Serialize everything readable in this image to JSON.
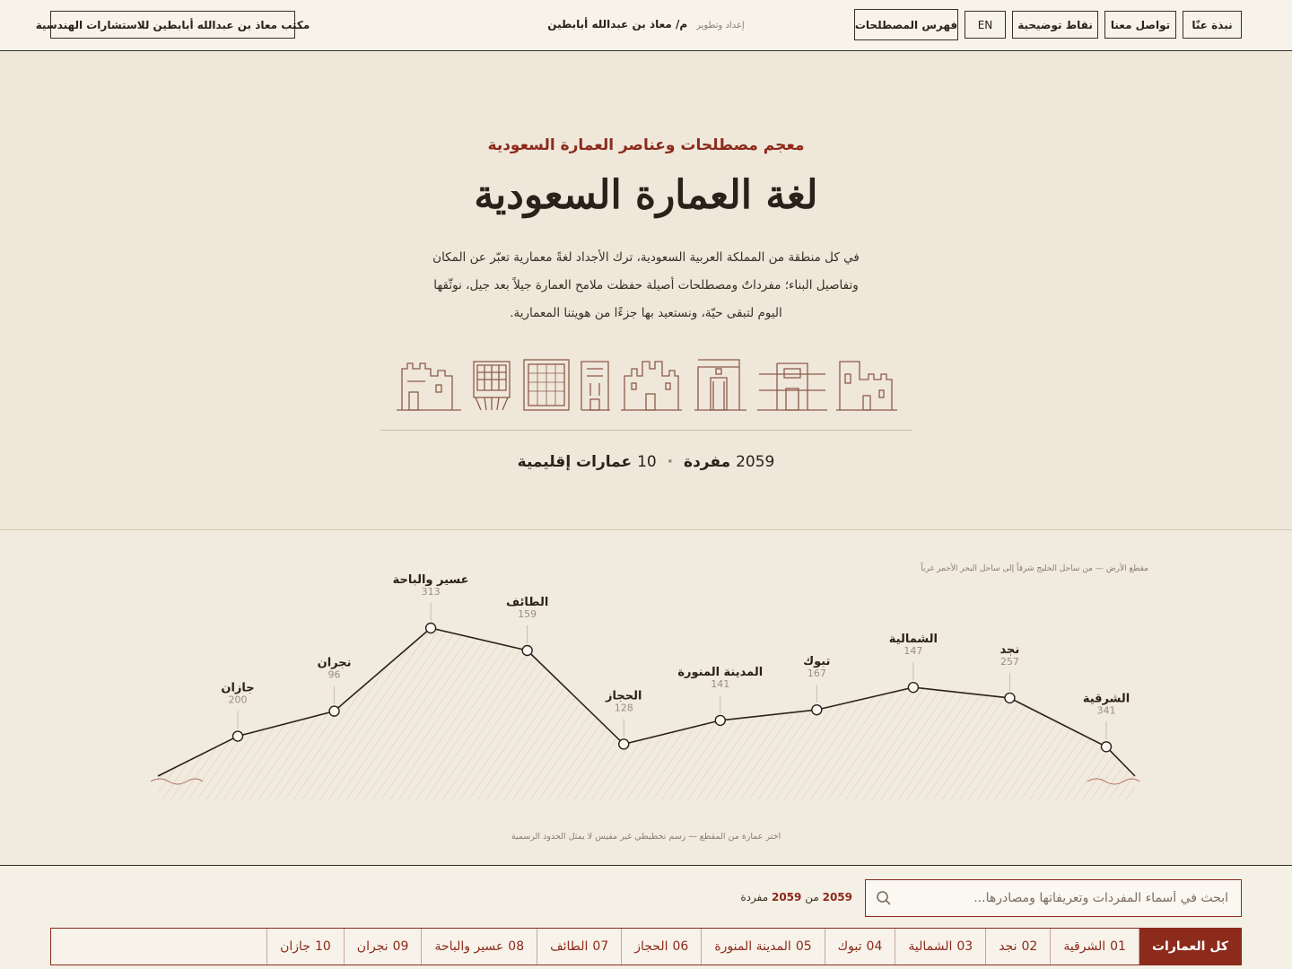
{
  "header": {
    "nav": {
      "about": "نبذة عنّا",
      "contact": "تواصل معنا",
      "notes": "نقاط توضيحية",
      "lang": "EN",
      "index": "فهرس المصطلحات"
    },
    "credit_prefix": "إعداد وتطوير",
    "credit_name": "م/ معاذ بن عبدالله أبابطين",
    "office": "مكتب معاذ بن عبدالله أبابطين للاستشارات الهندسية"
  },
  "hero": {
    "kicker": "معجم مصطلحات وعناصر العمارة السعودية",
    "title": "لغة العمارة السعودية",
    "desc_1": "في كل منطقة من المملكة العربية السعودية، ترك الأجداد لغةً معمارية تعبّر عن المكان",
    "desc_2": "وتفاصيل البناء؛ مفرداتٌ ومصطلحات أصيلة حفظت ملامح العمارة جيلاً بعد جيل، نوثّقها",
    "desc_3": "اليوم لتبقى حيّة، ونستعيد بها جزءًا من هويتنا المعمارية.",
    "terms_count": "2059",
    "terms_label": "مفردة",
    "regions_count": "10",
    "regions_label": "عمارات إقليمية"
  },
  "profile": {
    "caption": "مقطع الأرض — من ساحل الخليج شرقاً إلى ساحل البحر الأحمر غرباً",
    "hint": "اختر عمارة من المقطع — رسم تخطيطي غير مقيس لا يمثل الحدود الرسمية",
    "regions": [
      {
        "name": "الشرقية",
        "count": 341,
        "elevation": 0.1
      },
      {
        "name": "نجد",
        "count": 257,
        "elevation": 0.47
      },
      {
        "name": "الشمالية",
        "count": 147,
        "elevation": 0.55
      },
      {
        "name": "تبوك",
        "count": 167,
        "elevation": 0.38
      },
      {
        "name": "المدينة المنورة",
        "count": 141,
        "elevation": 0.3
      },
      {
        "name": "الحجاز",
        "count": 128,
        "elevation": 0.12
      },
      {
        "name": "الطائف",
        "count": 159,
        "elevation": 0.83
      },
      {
        "name": "عسير والباحة",
        "count": 313,
        "elevation": 1.0
      },
      {
        "name": "نجران",
        "count": 96,
        "elevation": 0.37
      },
      {
        "name": "جازان",
        "count": 200,
        "elevation": 0.18
      }
    ]
  },
  "search": {
    "placeholder": "ابحث في أسماء المفردات وتعريفاتها ومصادرها...",
    "shown": "2059",
    "of": "من",
    "total": "2059",
    "unit": "مفردة"
  },
  "tabs": [
    {
      "num": "",
      "label": "كل العمارات",
      "active": true
    },
    {
      "num": "01",
      "label": "الشرقية"
    },
    {
      "num": "02",
      "label": "نجد"
    },
    {
      "num": "03",
      "label": "الشمالية"
    },
    {
      "num": "04",
      "label": "تبوك"
    },
    {
      "num": "05",
      "label": "المدينة المنورة"
    },
    {
      "num": "06",
      "label": "الحجاز"
    },
    {
      "num": "07",
      "label": "الطائف"
    },
    {
      "num": "08",
      "label": "عسير والباحة"
    },
    {
      "num": "09",
      "label": "نجران"
    },
    {
      "num": "10",
      "label": "جازان"
    }
  ],
  "colors": {
    "accent": "#8c2a1c",
    "ink": "#2b211a",
    "paper": "#efe7da"
  }
}
